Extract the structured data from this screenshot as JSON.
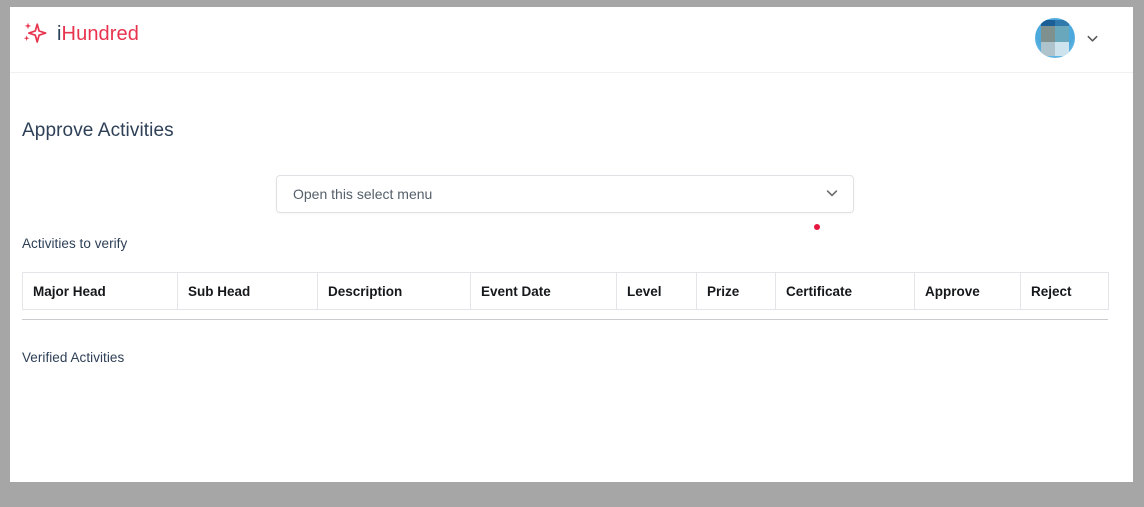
{
  "window": {
    "frame_color": "#a6a6a6",
    "page_background": "#ffffff"
  },
  "navbar": {
    "brand": {
      "icon": "sparkle-icon",
      "text_prefix": "i",
      "text_suffix": "Hundred",
      "full_text": "iHundred",
      "accent_color": "#e8344e",
      "prefix_color": "#2e4057"
    },
    "account": {
      "avatar": "user-avatar-image",
      "dropdown_icon": "chevron-down-icon"
    }
  },
  "main": {
    "title": "Approve Activities",
    "select": {
      "label": "Open this select menu",
      "icon": "chevron-down-icon",
      "options": [
        "Open this select menu"
      ]
    },
    "indicator": {
      "name": "red-dot-indicator",
      "color": "#e4173f"
    },
    "sections": {
      "to_verify_caption": "Activities to verify",
      "verified_caption": "Verified Activities"
    },
    "table": {
      "columns": [
        "Major Head",
        "Sub Head",
        "Description",
        "Event Date",
        "Level",
        "Prize",
        "Certificate",
        "Approve",
        "Reject"
      ],
      "rows": []
    }
  }
}
